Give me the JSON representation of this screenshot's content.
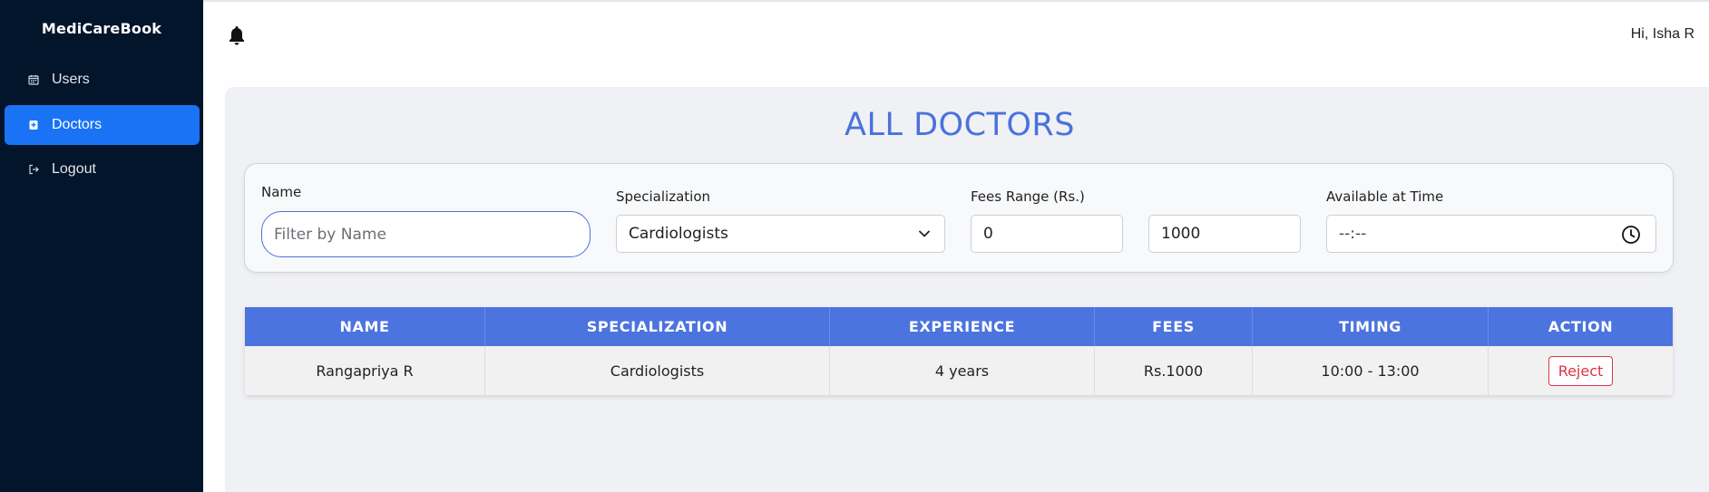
{
  "app": {
    "brand": "MediCareBook",
    "greeting": "Hi, Isha R"
  },
  "sidebar": {
    "items": [
      {
        "label": "Users",
        "icon": "calendar-icon",
        "active": false
      },
      {
        "label": "Doctors",
        "icon": "medical-bag-icon",
        "active": true
      },
      {
        "label": "Logout",
        "icon": "logout-icon",
        "active": false
      }
    ]
  },
  "header": {
    "icon": "bell-icon"
  },
  "page": {
    "title": "ALL DOCTORS"
  },
  "filters": {
    "name_label": "Name",
    "name_placeholder": "Filter by Name",
    "name_value": "",
    "specialization_label": "Specialization",
    "specialization_value": "Cardiologists",
    "fees_label": "Fees Range (Rs.)",
    "fees_min": "0",
    "fees_max": "1000",
    "time_label": "Available at Time",
    "time_value": "--:--"
  },
  "table": {
    "columns": [
      "NAME",
      "SPECIALIZATION",
      "EXPERIENCE",
      "FEES",
      "TIMING",
      "ACTION"
    ],
    "rows": [
      {
        "name": "Rangapriya R",
        "specialization": "Cardiologists",
        "experience": "4 years",
        "fees": "Rs.1000",
        "timing": "10:00 - 13:00",
        "action": "Reject"
      }
    ]
  },
  "colors": {
    "sidebar_bg": "#03152b",
    "active_nav": "#1a73f5",
    "accent": "#4a72dc",
    "table_header": "#4c74de",
    "reject": "#dc3545"
  }
}
